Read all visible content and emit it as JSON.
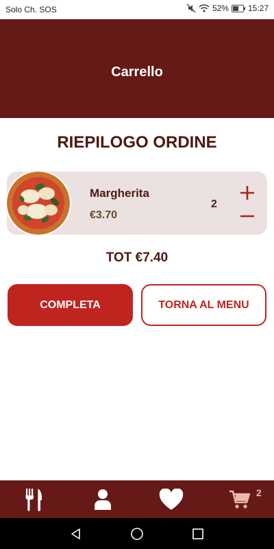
{
  "status_bar": {
    "carrier": "Solo Ch. SOS",
    "battery": "52%",
    "time": "15:27"
  },
  "header": {
    "title": "Carrello"
  },
  "order": {
    "section_title": "RIEPILOGO ORDINE",
    "items": [
      {
        "name": "Margherita",
        "price": "€3.70",
        "quantity": "2"
      }
    ],
    "total": "TOT €7.40"
  },
  "actions": {
    "complete_label": "COMPLETA",
    "back_label": "TORNA AL MENU"
  },
  "bottom_nav": {
    "items": [
      {
        "icon": "fork-knife-icon"
      },
      {
        "icon": "user-icon"
      },
      {
        "icon": "heart-icon"
      },
      {
        "icon": "cart-icon",
        "badge": "2"
      }
    ]
  },
  "colors": {
    "primary_dark": "#651a18",
    "accent_red": "#c0241f",
    "card_bg": "#ebe1e1",
    "cart_tint": "#ebb8ae"
  }
}
